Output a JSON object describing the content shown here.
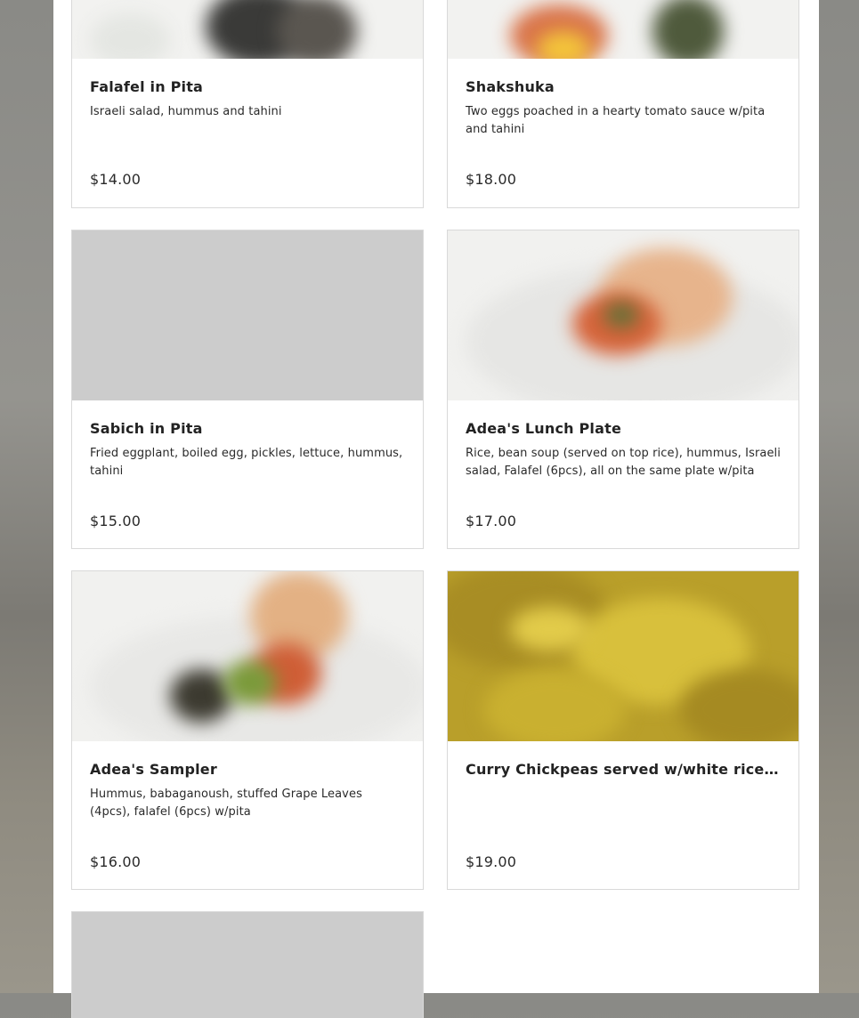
{
  "menu_items": [
    {
      "title": "Falafel in Pita",
      "description": "Israeli salad, hummus and tahini",
      "price": "$14.00"
    },
    {
      "title": "Shakshuka",
      "description": "Two eggs poached in a hearty tomato sauce w/pita and tahini",
      "price": "$18.00"
    },
    {
      "title": "Sabich in Pita",
      "description": "Fried eggplant, boiled egg, pickles, lettuce, hummus, tahini",
      "price": "$15.00"
    },
    {
      "title": "Adea's Lunch Plate",
      "description": "Rice, bean soup (served on top rice), hummus, Israeli salad, Falafel (6pcs), all on the same plate w/pita",
      "price": "$17.00"
    },
    {
      "title": "Adea's Sampler",
      "description": "Hummus, babaganoush, stuffed Grape Leaves (4pcs), falafel (6pcs) w/pita",
      "price": "$16.00"
    },
    {
      "title": "Curry Chickpeas served w/white rice and fries",
      "description": "",
      "price": "$19.00"
    }
  ]
}
